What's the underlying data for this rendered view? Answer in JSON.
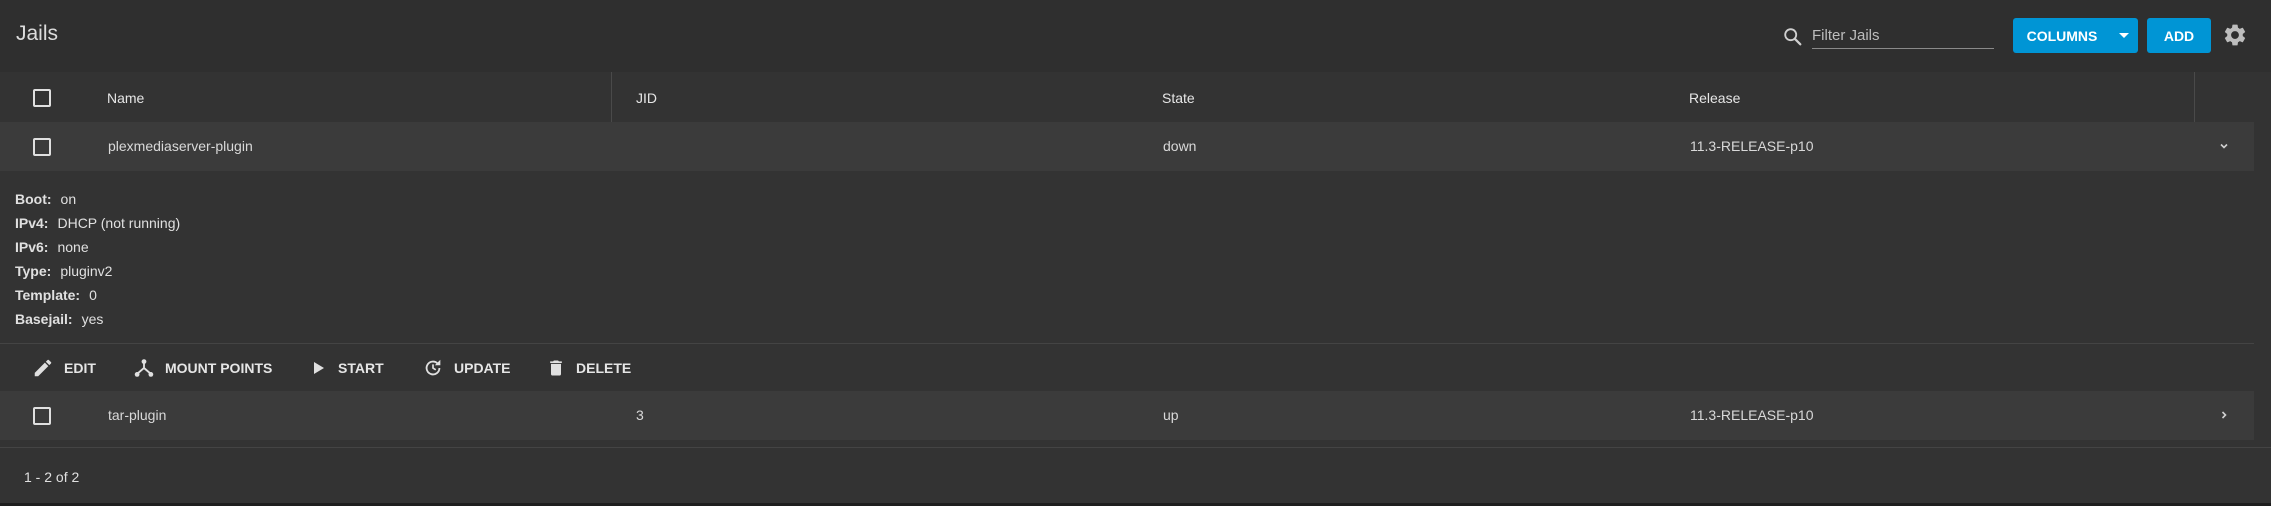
{
  "header": {
    "title": "Jails",
    "filter_placeholder": "Filter Jails",
    "columns_label": "COLUMNS",
    "add_label": "ADD",
    "icons": [
      "search-icon",
      "gear-icon",
      "chevron-down-icon"
    ],
    "accent_color": "#0095d5"
  },
  "table": {
    "columns": [
      "Name",
      "JID",
      "State",
      "Release"
    ],
    "rows": [
      {
        "name": "plexmediaserver-plugin",
        "jid": "",
        "state": "down",
        "release": "11.3-RELEASE-p10",
        "expanded": true
      },
      {
        "name": "tar-plugin",
        "jid": "3",
        "state": "up",
        "release": "11.3-RELEASE-p10",
        "expanded": false
      }
    ],
    "details": [
      {
        "key": "Boot:",
        "value": "on"
      },
      {
        "key": "IPv4:",
        "value": "DHCP (not running)"
      },
      {
        "key": "IPv6:",
        "value": "none"
      },
      {
        "key": "Type:",
        "value": "pluginv2"
      },
      {
        "key": "Template:",
        "value": "0"
      },
      {
        "key": "Basejail:",
        "value": "yes"
      }
    ],
    "actions": [
      "EDIT",
      "MOUNT POINTS",
      "START",
      "UPDATE",
      "DELETE"
    ]
  },
  "footer": {
    "pagination": "1 - 2 of 2"
  }
}
